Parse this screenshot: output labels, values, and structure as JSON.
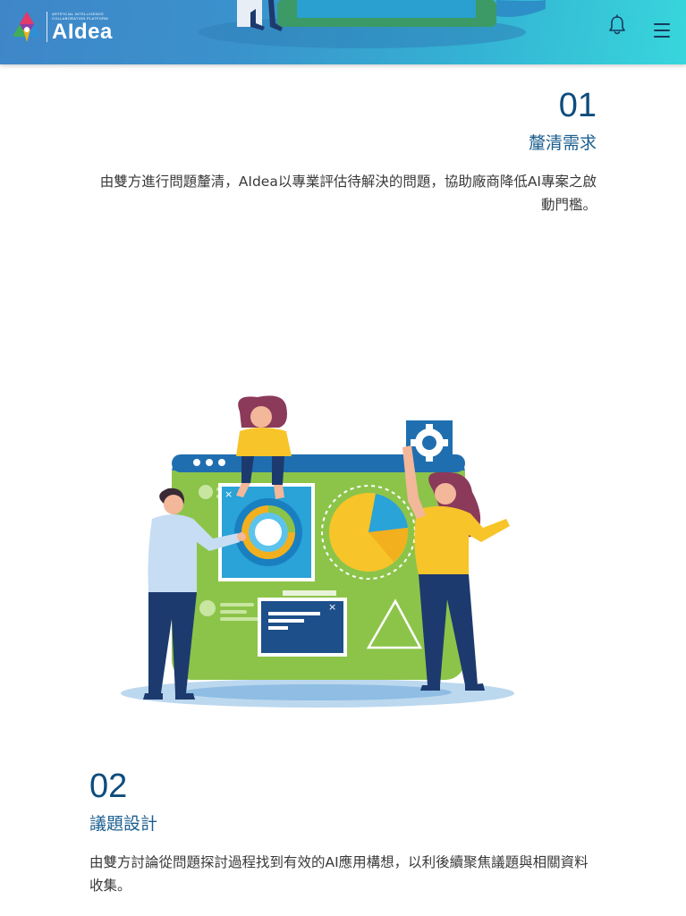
{
  "header": {
    "logo": {
      "tagline_line1": "ARTIFICIAL INTELLIGENCE",
      "tagline_line2": "COLLABORATION PLATFORM",
      "wordmark": "AIdea"
    },
    "bell_icon": "bell-icon",
    "menu_icon": "hamburger-menu-icon"
  },
  "steps": [
    {
      "number": "01",
      "title": "釐清需求",
      "description": "由雙方進行問題釐清，AIdea以專業評估待解決的問題，協助廠商降低AI專案之啟動門檻。"
    },
    {
      "number": "02",
      "title": "議題設計",
      "description": "由雙方討論從問題探討過程找到有效的AI應用構想，以利後續聚焦議題與相關資料收集。"
    }
  ],
  "colors": {
    "header_gradient_start": "#3f86c8",
    "header_gradient_end": "#38d6dc",
    "step_number": "#0f4c7c",
    "step_title": "#1c5f8f",
    "body_text": "#3a3a3a"
  }
}
